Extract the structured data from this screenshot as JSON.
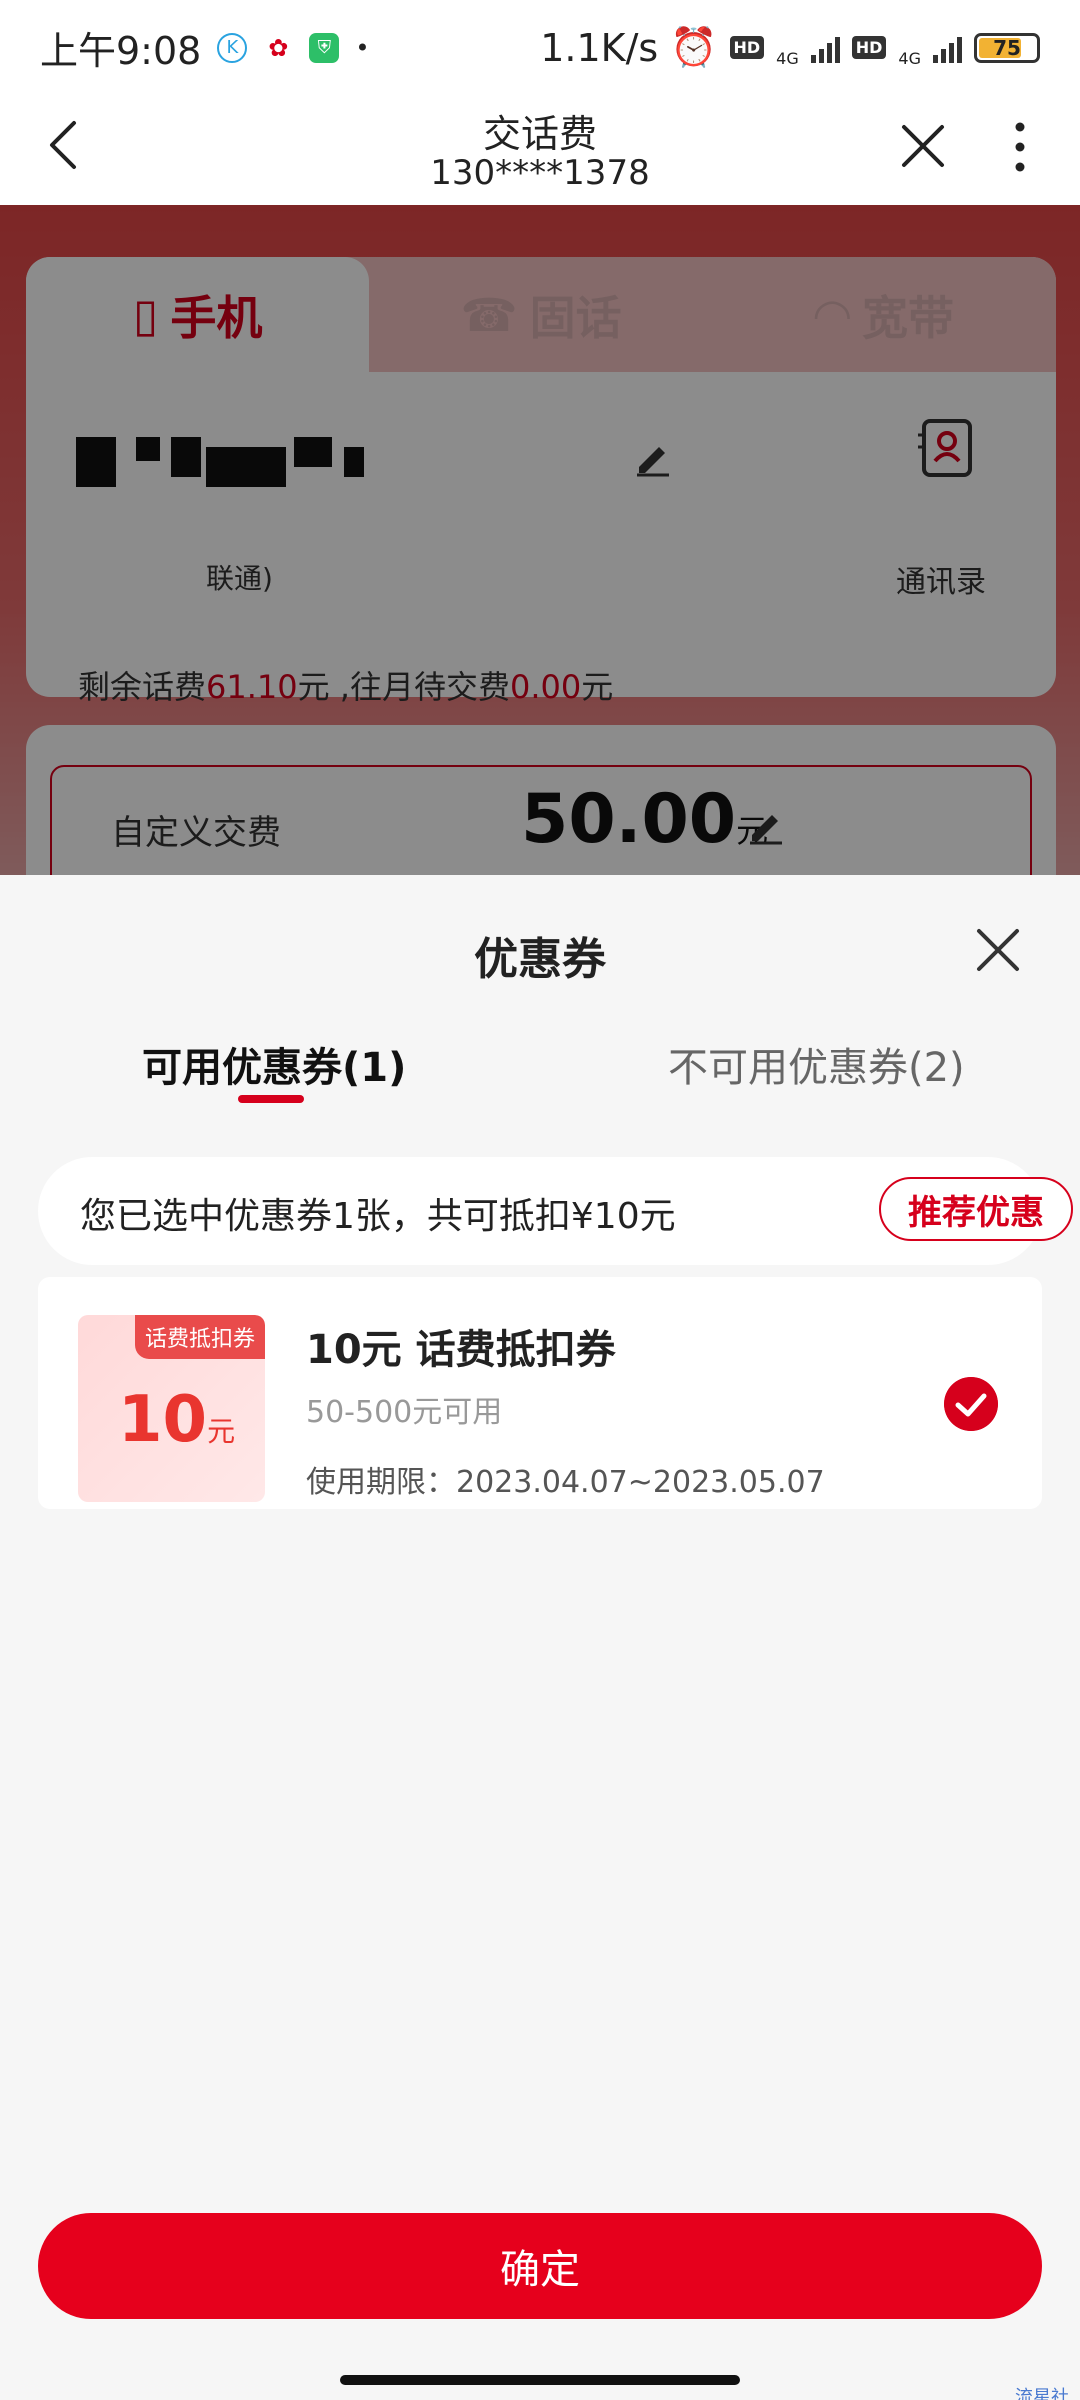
{
  "status_bar": {
    "time": "上午9:08",
    "net_speed": "1.1K/s",
    "net_type_1": "4G",
    "net_type_2": "4G",
    "hd_label": "HD",
    "battery": "75"
  },
  "titlebar": {
    "title": "交话费",
    "subtitle": "130****1378"
  },
  "background_page": {
    "tabs": [
      "手机",
      "固话",
      "宽带"
    ],
    "carrier_text": "联通)",
    "contacts_label": "通讯录",
    "balance_prefix": "剩余话费",
    "balance_value": "61.10",
    "balance_mid": "元 ,往月待交费",
    "owed_value": "0.00",
    "balance_suffix": "元",
    "pay_label": "自定义交费",
    "pay_amount": "50.00",
    "pay_unit": "元"
  },
  "sheet": {
    "title": "优惠券",
    "tab_available": "可用优惠券(1)",
    "tab_unavailable": "不可用优惠券(2)",
    "summary_text": "您已选中优惠券1张，共可抵扣¥10元",
    "recommend_label": "推荐优惠",
    "coupon": {
      "tag": "话费抵扣券",
      "amount": "10",
      "amount_unit": "元",
      "name": "10元 话费抵扣券",
      "range": "50-500元可用",
      "period": "使用期限：2023.04.07~2023.05.07",
      "selected": true
    },
    "confirm_label": "确定"
  },
  "watermark": "流星社区",
  "colors": {
    "accent": "#d6001c",
    "confirm": "#e6001c"
  }
}
